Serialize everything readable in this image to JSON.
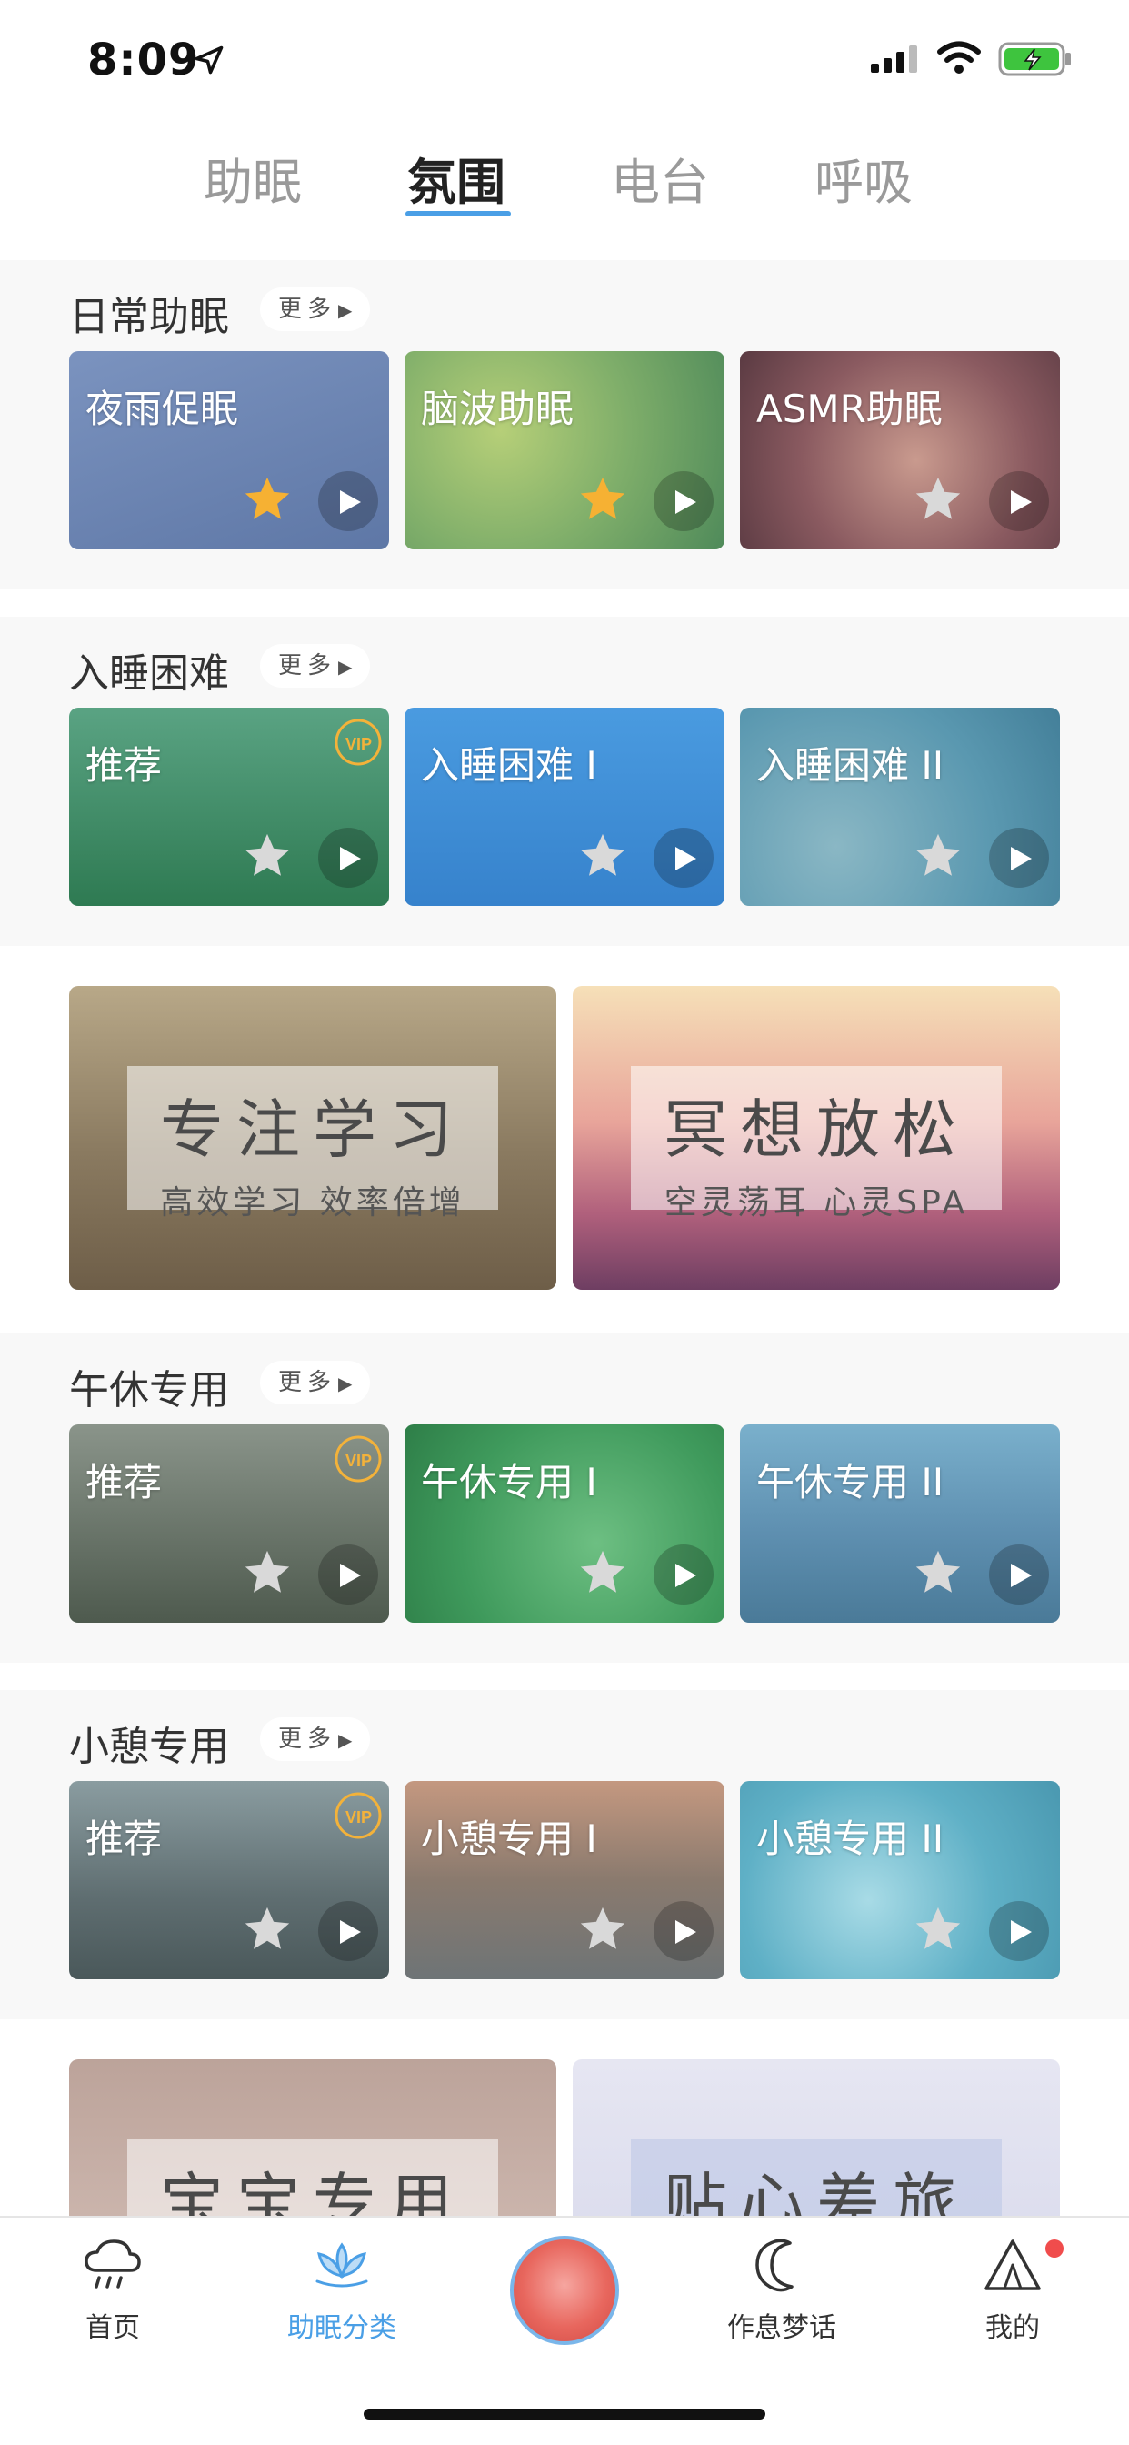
{
  "status": {
    "time": "8:09"
  },
  "tabs": [
    {
      "label": "助眠"
    },
    {
      "label": "氛围"
    },
    {
      "label": "电台"
    },
    {
      "label": "呼吸"
    }
  ],
  "more_label": "更多",
  "sections": [
    {
      "title": "日常助眠",
      "cards": [
        {
          "title": "夜雨促眠",
          "favorited": true,
          "vip": false,
          "color": "#6d86b3"
        },
        {
          "title": "脑波助眠",
          "favorited": true,
          "vip": false,
          "color": "#8bb36a"
        },
        {
          "title": "ASMR助眠",
          "favorited": false,
          "vip": false,
          "color": "#8a5a60"
        }
      ]
    },
    {
      "title": "入睡困难",
      "cards": [
        {
          "title": "推荐",
          "favorited": false,
          "vip": true,
          "color": "#3f8a66"
        },
        {
          "title": "入睡困难 I",
          "favorited": false,
          "vip": false,
          "color": "#3f8fd6"
        },
        {
          "title": "入睡困难 II",
          "favorited": false,
          "vip": false,
          "color": "#5a98b0"
        }
      ]
    },
    {
      "title": "午休专用",
      "cards": [
        {
          "title": "推荐",
          "favorited": false,
          "vip": true,
          "color": "#5f6a5a"
        },
        {
          "title": "午休专用 I",
          "favorited": false,
          "vip": false,
          "color": "#3f9a5c"
        },
        {
          "title": "午休专用 II",
          "favorited": false,
          "vip": false,
          "color": "#5e8fb0"
        }
      ]
    },
    {
      "title": "小憩专用",
      "cards": [
        {
          "title": "推荐",
          "favorited": false,
          "vip": true,
          "color": "#5e6d70"
        },
        {
          "title": "小憩专用 I",
          "favorited": false,
          "vip": false,
          "color": "#8a7a6e"
        },
        {
          "title": "小憩专用 II",
          "favorited": false,
          "vip": false,
          "color": "#5fb0c6"
        }
      ]
    }
  ],
  "banners_1": [
    {
      "title": "专注学习",
      "subtitle": "高效学习 效率倍增"
    },
    {
      "title": "冥想放松",
      "subtitle": "空灵荡耳 心灵SPA"
    }
  ],
  "banners_2": [
    {
      "title": "宝宝专用"
    },
    {
      "title": "贴心差旅"
    }
  ],
  "bottom_nav": [
    {
      "label": "首页",
      "icon": "rain-cloud-icon"
    },
    {
      "label": "助眠分类",
      "icon": "lotus-icon"
    },
    {
      "label": "",
      "icon": "player-disc-icon"
    },
    {
      "label": "作息梦话",
      "icon": "moon-icon"
    },
    {
      "label": "我的",
      "icon": "tent-icon"
    }
  ],
  "colors": {
    "accent": "#4a9fe6",
    "star_active": "#f6b133",
    "star_inactive": "#d9d9d9",
    "badge": "#f04c4c"
  }
}
